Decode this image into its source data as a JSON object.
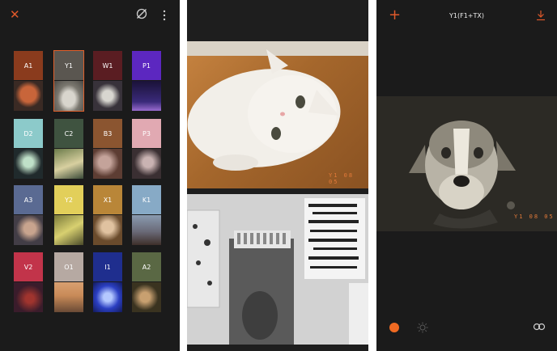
{
  "filter_picker": {
    "close_label": "✕",
    "tiles": [
      {
        "code": "A1",
        "color": "#8a3b1d",
        "thumb": "#3a2a24"
      },
      {
        "code": "Y1",
        "color": "#5a5650",
        "thumb": "#8a8a82",
        "selected": true
      },
      {
        "code": "W1",
        "color": "#5a1d22",
        "thumb": "#38323a"
      },
      {
        "code": "P1",
        "color": "#5c27c0",
        "thumb": "#241a4a"
      },
      {
        "code": "D2",
        "color": "#8ccaca",
        "thumb": "#202a2c"
      },
      {
        "code": "C2",
        "color": "#3f5340",
        "thumb": "#3a4a38"
      },
      {
        "code": "B3",
        "color": "#8b5530",
        "thumb": "#5d3d33"
      },
      {
        "code": "P3",
        "color": "#e1a9b2",
        "thumb": "#3a2f32"
      },
      {
        "code": "A3",
        "color": "#5a6a92",
        "thumb": "#423d46"
      },
      {
        "code": "Y2",
        "color": "#e2cf5a",
        "thumb": "#4a4a2a"
      },
      {
        "code": "X1",
        "color": "#b98638",
        "thumb": "#6a4b2c"
      },
      {
        "code": "K1",
        "color": "#87aac6",
        "thumb": "#4b4f5e"
      },
      {
        "code": "V2",
        "color": "#c2344a",
        "thumb": "#3a1c2b"
      },
      {
        "code": "O1",
        "color": "#b6a9a2",
        "thumb": "#6a4a35"
      },
      {
        "code": "I1",
        "color": "#1f2e8e",
        "thumb": "#2b3fc2"
      },
      {
        "code": "A2",
        "color": "#5a6844",
        "thumb": "#3a3320"
      }
    ]
  },
  "gallery": {
    "photo1_date": "Y1  08  05"
  },
  "editor": {
    "title": "Y1(F1+TX)",
    "add_label": "+",
    "photo_date": "Y1  08  05"
  },
  "colors": {
    "accent": "#e0592a"
  }
}
